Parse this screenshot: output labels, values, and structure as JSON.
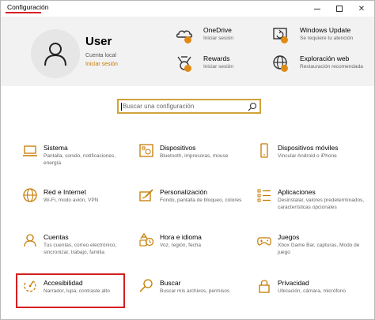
{
  "window": {
    "title": "Configuración",
    "minimize_label": "—",
    "maximize_label": "",
    "close_label": "✕"
  },
  "user": {
    "name": "User",
    "account_type": "Cuenta local",
    "sign_in_link": "Iniciar sesión",
    "icon": "person-icon"
  },
  "header_items": [
    {
      "title": "OneDrive",
      "subtitle": "Iniciar sesión",
      "icon": "onedrive-icon"
    },
    {
      "title": "Windows Update",
      "subtitle": "Se requiere tu atención",
      "icon": "windows-update-icon"
    },
    {
      "title": "Rewards",
      "subtitle": "Iniciar sesión",
      "icon": "rewards-icon"
    },
    {
      "title": "Exploración web",
      "subtitle": "Restauración recomendada",
      "icon": "globe-icon"
    }
  ],
  "search": {
    "placeholder": "Buscar una configuración",
    "icon": "search-icon"
  },
  "tiles": [
    {
      "title": "Sistema",
      "subtitle": "Pantalla, sonido, notificaciones, energía",
      "icon": "laptop-icon"
    },
    {
      "title": "Dispositivos",
      "subtitle": "Bluetooth, impresoras, mouse",
      "icon": "devices-icon"
    },
    {
      "title": "Dispositivos móviles",
      "subtitle": "Vincular Android o iPhone",
      "icon": "phone-icon"
    },
    {
      "title": "Red e Internet",
      "subtitle": "Wi-Fi, modo avión, VPN",
      "icon": "globe-icon"
    },
    {
      "title": "Personalización",
      "subtitle": "Fondo, pantalla de bloqueo, colores",
      "icon": "paint-icon"
    },
    {
      "title": "Aplicaciones",
      "subtitle": "Desinstalar, valores predeterminados, características opcionales",
      "icon": "apps-icon"
    },
    {
      "title": "Cuentas",
      "subtitle": "Tus cuentas, correo electrónico, sincronizar, trabajo, familia",
      "icon": "person-icon"
    },
    {
      "title": "Hora e idioma",
      "subtitle": "Voz, región, fecha",
      "icon": "time-language-icon"
    },
    {
      "title": "Juegos",
      "subtitle": "Xbox Game Bar, capturas, Modo de juego",
      "icon": "gamepad-icon"
    },
    {
      "title": "Accesibilidad",
      "subtitle": "Narrador, lupa, contraste alto",
      "icon": "accessibility-icon"
    },
    {
      "title": "Buscar",
      "subtitle": "Buscar mis archivos, permisos",
      "icon": "search-icon"
    },
    {
      "title": "Privacidad",
      "subtitle": "Ubicación, cámara, micrófono",
      "icon": "lock-icon"
    }
  ],
  "colors": {
    "accent": "#c57a00",
    "icon_stroke": "#c57a00",
    "highlight": "#d61f1f",
    "header_bg": "#f2f2f2",
    "badge": "#e08a15"
  }
}
